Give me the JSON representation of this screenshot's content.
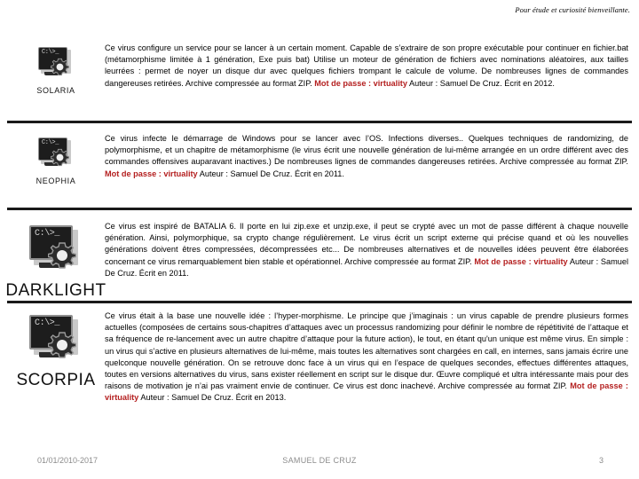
{
  "header": {
    "note": "Pour étude et curiosité bienveillante."
  },
  "entries": [
    {
      "icon_name": "virus-monitor-icon",
      "label": "SOLARIA",
      "label_size": "small",
      "text_parts": [
        {
          "type": "plain",
          "text": "Ce virus configure un service pour se lancer à un certain moment. Capable de s’extraire de son propre exécutable pour continuer en fichier.bat (métamorphisme limitée à 1 génération, Exe puis bat) Utilise un moteur de génération de fichiers avec nominations aléatoires, aux tailles leurrées : permet de noyer un disque dur avec quelques fichiers trompant le calcule de volume. De nombreuses lignes de commandes dangereuses retirées. Archive compressée au format ZIP. "
        },
        {
          "type": "password",
          "text": "Mot de passe : virtuality"
        },
        {
          "type": "plain",
          "text": " Auteur : Samuel De Cruz. Écrit en 2012."
        }
      ]
    },
    {
      "icon_name": "virus-monitor-icon",
      "label": "NEOPHIA",
      "label_size": "small",
      "text_parts": [
        {
          "type": "plain",
          "text": "Ce virus infecte le démarrage de Windows pour se lancer avec l’OS. Infections diverses.. Quelques techniques de randomizing, de polymorphisme, et un chapitre de métamorphisme (le virus écrit une nouvelle génération de lui-même arrangée en un ordre différent avec des commandes offensives auparavant inactives.)  De nombreuses lignes de commandes dangereuses retirées. Archive compressée au format ZIP. "
        },
        {
          "type": "password",
          "text": "Mot de passe : virtuality"
        },
        {
          "type": "plain",
          "text": " Auteur : Samuel De Cruz. Écrit en 2011."
        }
      ]
    },
    {
      "icon_name": "virus-monitor-icon",
      "label": "DARKLIGHT",
      "label_size": "large",
      "text_parts": [
        {
          "type": "plain",
          "text": "Ce virus est inspiré de BATALIA 6. Il porte en lui zip.exe et unzip.exe, il peut se crypté avec un mot de passe différent à chaque nouvelle génération. Ainsi, polymorphique, sa crypto change  régulièrement. Le virus écrit un script externe qui précise quand et où les nouvelles générations doivent êtres compressées, décompressées etc... De nombreuses alternatives et de nouvelles idées peuvent être élaborées concernant ce virus remarquablement bien stable et opérationnel. Archive compressée au format ZIP.  "
        },
        {
          "type": "password",
          "text": "Mot de passe : virtuality"
        },
        {
          "type": "plain",
          "text": " Auteur : Samuel De Cruz. Écrit en 2011."
        }
      ]
    },
    {
      "icon_name": "virus-monitor-icon",
      "label": "SCORPIA",
      "label_size": "large",
      "text_parts": [
        {
          "type": "plain",
          "text": "Ce virus était  à la base une nouvelle idée : l’hyper-morphisme. Le principe que j’imaginais : un virus capable de prendre plusieurs formes actuelles (composées de certains sous-chapitres d’attaques avec un processus randomizing pour définir le nombre de répétitivité de l’attaque et sa fréquence de re-lancement avec un autre chapitre d’attaque pour la future action), le tout, en étant qu'un unique est même virus. En simple : un virus qui s’active en plusieurs alternatives de lui-même, mais toutes les alternatives sont chargées en call, en internes,  sans jamais écrire une quelconque nouvelle génération. On se retrouve donc face à un virus qui en l’espace de quelques secondes, effectues différentes attaques, toutes en versions alternatives du virus, sans exister réellement en script sur le disque dur. Œuvre compliqué et ultra intéressante mais pour des raisons de motivation je n’ai pas vraiment envie de continuer. Ce virus est donc inachevé. Archive compressée au format ZIP. "
        },
        {
          "type": "password",
          "text": "Mot de passe : virtuality"
        },
        {
          "type": "plain",
          "text": " Auteur : Samuel De Cruz. Écrit en 2013."
        }
      ]
    }
  ],
  "icon_glyph": {
    "code_text": "C:\\>_"
  },
  "footer": {
    "left": "01/01/2010-2017",
    "center": "SAMUEL DE CRUZ",
    "page": "3"
  },
  "colors": {
    "password_red": "#b41f1f",
    "divider": "#1a1a1a",
    "footer_gray": "#8c8c8c"
  }
}
